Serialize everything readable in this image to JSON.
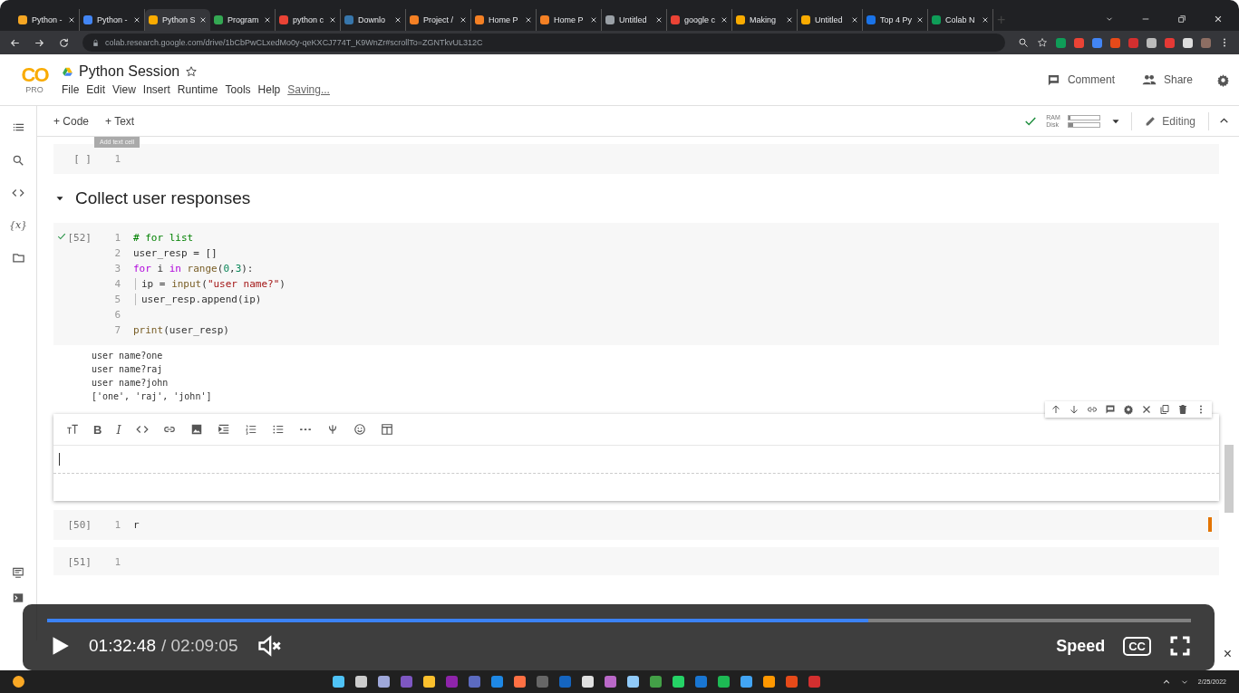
{
  "browser": {
    "tabs": [
      {
        "title": "Python -",
        "color": "#f5a623",
        "selected": false
      },
      {
        "title": "Python -",
        "color": "#4285f4",
        "selected": false
      },
      {
        "title": "Python S",
        "color": "#f9ab00",
        "selected": true
      },
      {
        "title": "Program",
        "color": "#34a853",
        "selected": false
      },
      {
        "title": "python c",
        "color": "#ea4335",
        "selected": false
      },
      {
        "title": "Downlo",
        "color": "#3776ab",
        "selected": false
      },
      {
        "title": "Project /",
        "color": "#f48024",
        "selected": false
      },
      {
        "title": "Home P",
        "color": "#f48024",
        "selected": false
      },
      {
        "title": "Home P",
        "color": "#f48024",
        "selected": false
      },
      {
        "title": "Untitled",
        "color": "#9aa0a6",
        "selected": false
      },
      {
        "title": "google c",
        "color": "#ea4335",
        "selected": false
      },
      {
        "title": "Making",
        "color": "#f9ab00",
        "selected": false
      },
      {
        "title": "Untitled",
        "color": "#f9ab00",
        "selected": false
      },
      {
        "title": "Top 4 Py",
        "color": "#1a73e8",
        "selected": false
      },
      {
        "title": "Colab N",
        "color": "#0f9d58",
        "selected": false
      }
    ],
    "new_tab": "+",
    "address": "colab.research.google.com/drive/1bCbPwCLxedMo0y-qeKXCJ774T_K9WnZr#scrollTo=ZGNTkvUL312C"
  },
  "notebook": {
    "logo": "CO",
    "plan": "PRO",
    "title": "Python Session",
    "menu": [
      "File",
      "Edit",
      "View",
      "Insert",
      "Runtime",
      "Tools",
      "Help"
    ],
    "save_status": "Saving...",
    "comment": "Comment",
    "share": "Share"
  },
  "toolbar": {
    "add_code": "+ Code",
    "add_text": "+ Text",
    "connected": true,
    "mode": "Editing",
    "tooltip": "Add text cell",
    "resources": [
      {
        "label": "RAM",
        "level": 0.04
      },
      {
        "label": "Disk",
        "level": 0.15
      }
    ]
  },
  "sidebar": {
    "variables": "{x}"
  },
  "cells": [
    {
      "kind": "code",
      "prompt": "[ ]",
      "ran": false,
      "modified": false,
      "lines": [
        {
          "num": "1"
        }
      ]
    },
    {
      "kind": "heading",
      "text": "Collect user responses",
      "expanded": true
    },
    {
      "kind": "code",
      "prompt": "[52]",
      "ran": true,
      "modified": false,
      "lines": [
        {
          "num": "1",
          "tokens": [
            {
              "t": "# for list",
              "kind": "comment"
            }
          ]
        },
        {
          "num": "2",
          "tokens": [
            {
              "t": "user_resp = []",
              "kind": "plain"
            }
          ]
        },
        {
          "num": "3",
          "tokens": [
            {
              "t": "for",
              "kind": "keyword"
            },
            {
              "t": " i ",
              "kind": "plain"
            },
            {
              "t": "in",
              "kind": "keyword"
            },
            {
              "t": " range",
              "kind": "builtin"
            },
            {
              "t": "(",
              "kind": "plain"
            },
            {
              "t": "0",
              "kind": "number"
            },
            {
              "t": ",",
              "kind": "plain"
            },
            {
              "t": "3",
              "kind": "number"
            },
            {
              "t": "):",
              "kind": "plain"
            }
          ]
        },
        {
          "num": "4",
          "indent": true,
          "tokens": [
            {
              "t": "ip = ",
              "kind": "plain"
            },
            {
              "t": "input",
              "kind": "builtin"
            },
            {
              "t": "(",
              "kind": "plain"
            },
            {
              "t": "\"user name?\"",
              "kind": "string"
            },
            {
              "t": ")",
              "kind": "plain"
            }
          ]
        },
        {
          "num": "5",
          "indent": true,
          "tokens": [
            {
              "t": "user_resp.append(ip)",
              "kind": "plain"
            }
          ]
        },
        {
          "num": "6"
        },
        {
          "num": "7",
          "tokens": [
            {
              "t": "print",
              "kind": "builtin"
            },
            {
              "t": "(user_resp)",
              "kind": "plain"
            }
          ]
        }
      ],
      "output": [
        "user name?one",
        "user name?raj",
        "user name?john",
        "['one', 'raj', 'john']"
      ]
    },
    {
      "kind": "text_editor",
      "bold": "B",
      "italic": "I"
    },
    {
      "kind": "code",
      "prompt": "[50]",
      "ran": false,
      "modified": true,
      "lines": [
        {
          "num": "1",
          "tokens": [
            {
              "t": "r",
              "kind": "plain"
            }
          ]
        }
      ]
    },
    {
      "kind": "code",
      "prompt": "[51]",
      "ran": false,
      "modified": false,
      "lines": [
        {
          "num": "1"
        }
      ]
    }
  ],
  "status_bar": {
    "close": "×"
  },
  "player": {
    "playing": false,
    "level": 0.718,
    "current": "01:32:48",
    "total": "/ 02:09:05",
    "muted": true,
    "speed": "Speed",
    "captions": "CC"
  },
  "taskbar": {
    "date": "2/25/2022"
  }
}
